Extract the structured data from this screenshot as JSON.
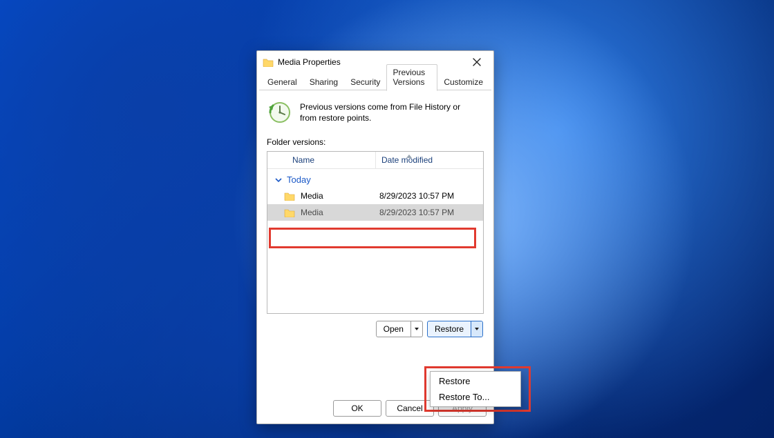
{
  "window": {
    "title": "Media Properties"
  },
  "tabs": {
    "general": "General",
    "sharing": "Sharing",
    "security": "Security",
    "previous_versions": "Previous Versions",
    "customize": "Customize"
  },
  "description": "Previous versions come from File History or from restore points.",
  "section_label": "Folder versions:",
  "columns": {
    "name": "Name",
    "date": "Date modified"
  },
  "group": {
    "today": "Today"
  },
  "rows": [
    {
      "name": "Media",
      "date": "8/29/2023 10:57 PM",
      "selected": false
    },
    {
      "name": "Media",
      "date": "8/29/2023 10:57 PM",
      "selected": true
    }
  ],
  "buttons": {
    "open": "Open",
    "restore": "Restore",
    "ok": "OK",
    "cancel": "Cancel",
    "apply": "Apply"
  },
  "menu": {
    "restore": "Restore",
    "restore_to": "Restore To..."
  }
}
